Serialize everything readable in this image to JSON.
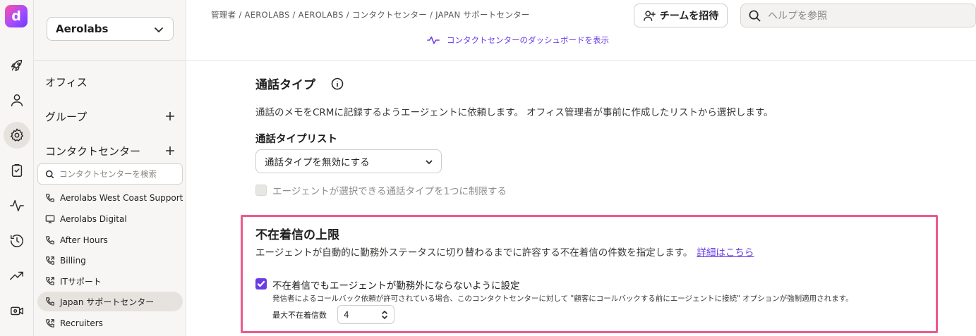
{
  "app": {
    "logo_letter": "d"
  },
  "rail": {
    "items": [
      {
        "icon": "rocket-icon"
      },
      {
        "icon": "user-icon"
      },
      {
        "icon": "gear-icon",
        "active": true
      },
      {
        "icon": "clipboard-icon"
      },
      {
        "icon": "activity-icon"
      },
      {
        "icon": "history-icon"
      },
      {
        "icon": "trending-icon"
      },
      {
        "icon": "video-icon"
      }
    ]
  },
  "sidebar": {
    "org": "Aerolabs",
    "office_label": "オフィス",
    "groups_label": "グループ",
    "contact_centers_label": "コンタクトセンター",
    "search_placeholder": "コンタクトセンターを検索",
    "contact_centers": [
      {
        "label": "Aerolabs West Coast Support",
        "icon": "phone-icon"
      },
      {
        "label": "Aerolabs Digital",
        "icon": "monitor-icon"
      },
      {
        "label": "After Hours",
        "icon": "phone-icon"
      },
      {
        "label": "Billing",
        "icon": "phone-forward-icon"
      },
      {
        "label": "ITサポート",
        "icon": "phone-forward-icon"
      },
      {
        "label": "Japan サポートセンター",
        "icon": "phone-icon",
        "selected": true
      },
      {
        "label": "Recruiters",
        "icon": "phone-forward-icon"
      }
    ]
  },
  "header": {
    "breadcrumb": "管理者 / AEROLABS / AEROLABS / コンタクトセンター / JAPAN サポートセンター",
    "dashboard_link": "コンタクトセンターのダッシュボードを表示",
    "invite_button": "チームを招待",
    "help_placeholder": "ヘルプを参照"
  },
  "call_types": {
    "title": "通話タイプ",
    "description": "通話のメモをCRMに記録するようエージェントに依頼します。 オフィス管理者が事前に作成したリストから選択します。",
    "list_label": "通話タイプリスト",
    "select_value": "通話タイプを無効にする",
    "limit_checkbox_label": "エージェントが選択できる通話タイプを1つに制限する",
    "limit_checkbox_checked": false,
    "limit_checkbox_disabled": true
  },
  "missed_calls": {
    "title": "不在着信の上限",
    "description": "エージェントが自動的に勤務外ステータスに切り替わるまでに許容する不在着信の件数を指定します。",
    "more_link": "詳細はこちら",
    "checkbox_label": "不在着信でもエージェントが勤務外にならないように設定",
    "checkbox_checked": true,
    "checkbox_sublabel": "発信者によるコールバック依頼が許可されている場合、このコンタクトセンターに対して \"顧客にコールバックする前にエージェントに接続\" オプションが強制適用されます。",
    "max_label": "最大不在着信数",
    "max_value": "4"
  },
  "colors": {
    "accent": "#6a3ce6",
    "highlight_border": "#ec5a8c",
    "sidebar_bg": "#f7f6f5"
  }
}
